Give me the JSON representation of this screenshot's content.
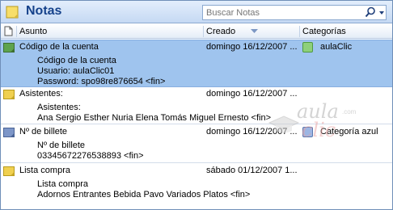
{
  "header": {
    "title": "Notas"
  },
  "search": {
    "placeholder": "Buscar Notas"
  },
  "columns": {
    "subject": "Asunto",
    "created": "Creado",
    "categories": "Categorías"
  },
  "notes": [
    {
      "subject": "Código de la cuenta",
      "created": "domingo 16/12/2007 ...",
      "category": "aulaClic",
      "category_color": "#8ed07a",
      "icon_color": "#5ea34e",
      "selected": true,
      "lines": [
        "Código de la cuenta",
        "Usuario: aulaClic01",
        "Password: spo98re876654 <fin>"
      ]
    },
    {
      "subject": "Asistentes:",
      "created": "domingo 16/12/2007 ...",
      "category": "",
      "icon_color": "#f0d050",
      "selected": false,
      "lines": [
        "Asistentes:",
        "Ana Sergio Esther Nuria Elena Tomás Miguel Ernesto <fin>"
      ]
    },
    {
      "subject": "Nº de billete",
      "created": "domingo 16/12/2007 ...",
      "category": "Categoría azul",
      "category_color": "#9db6e3",
      "icon_color": "#7d96c8",
      "selected": false,
      "lines": [
        "Nº de billete",
        "03345672276538893 <fin>"
      ]
    },
    {
      "subject": "Lista compra",
      "created": "sábado 01/12/2007 1...",
      "category": "",
      "icon_color": "#f0d050",
      "selected": false,
      "lines": [
        "Lista compra",
        "Adornos Entrantes Bebida Pavo Variados Platos <fin>"
      ]
    }
  ],
  "watermark": {
    "brand": "aula",
    "brand2": "clic",
    "domain_suffix": ".com",
    "color_brand": "#aaaaaa",
    "color_brand2": "#e8a0a0"
  },
  "colors": {
    "header_title": "#15428b",
    "selected_row": "#9fc4ee",
    "border": "#6f8fb8"
  }
}
